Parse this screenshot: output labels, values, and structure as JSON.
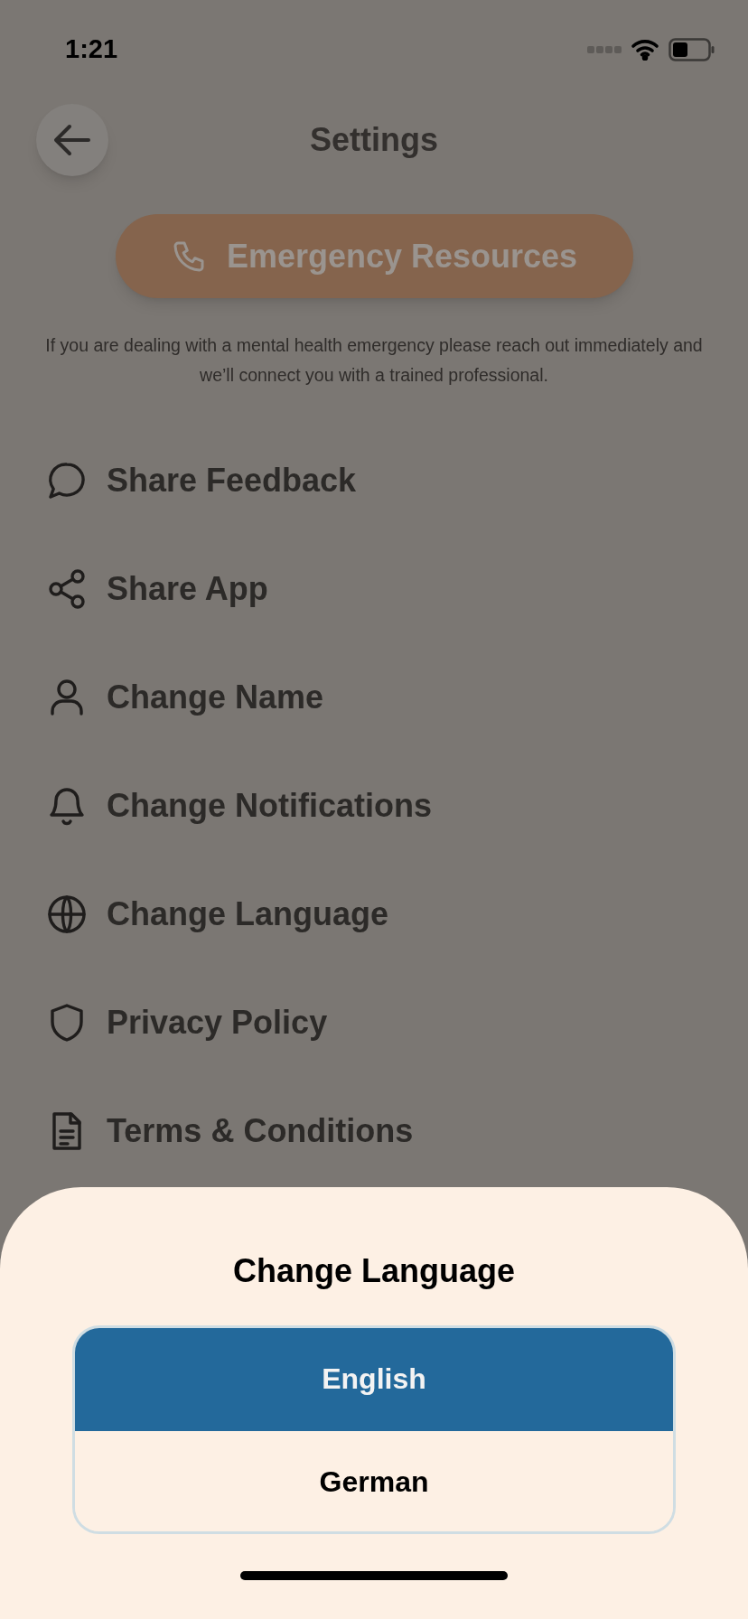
{
  "status_bar": {
    "time": "1:21"
  },
  "header": {
    "title": "Settings"
  },
  "emergency": {
    "label": "Emergency Resources",
    "note": "If you are dealing with a mental health emergency please reach out immediately and we’ll connect you with a trained professional."
  },
  "menu": [
    {
      "kind": "feedback",
      "label": "Share Feedback"
    },
    {
      "kind": "share",
      "label": "Share App"
    },
    {
      "kind": "person",
      "label": "Change Name"
    },
    {
      "kind": "bell",
      "label": "Change Notifications"
    },
    {
      "kind": "globe",
      "label": "Change Language"
    },
    {
      "kind": "shield",
      "label": "Privacy Policy"
    },
    {
      "kind": "document",
      "label": "Terms & Conditions"
    }
  ],
  "sheet": {
    "title": "Change Language",
    "options": [
      {
        "label": "English",
        "selected": true
      },
      {
        "label": "German",
        "selected": false
      }
    ]
  }
}
